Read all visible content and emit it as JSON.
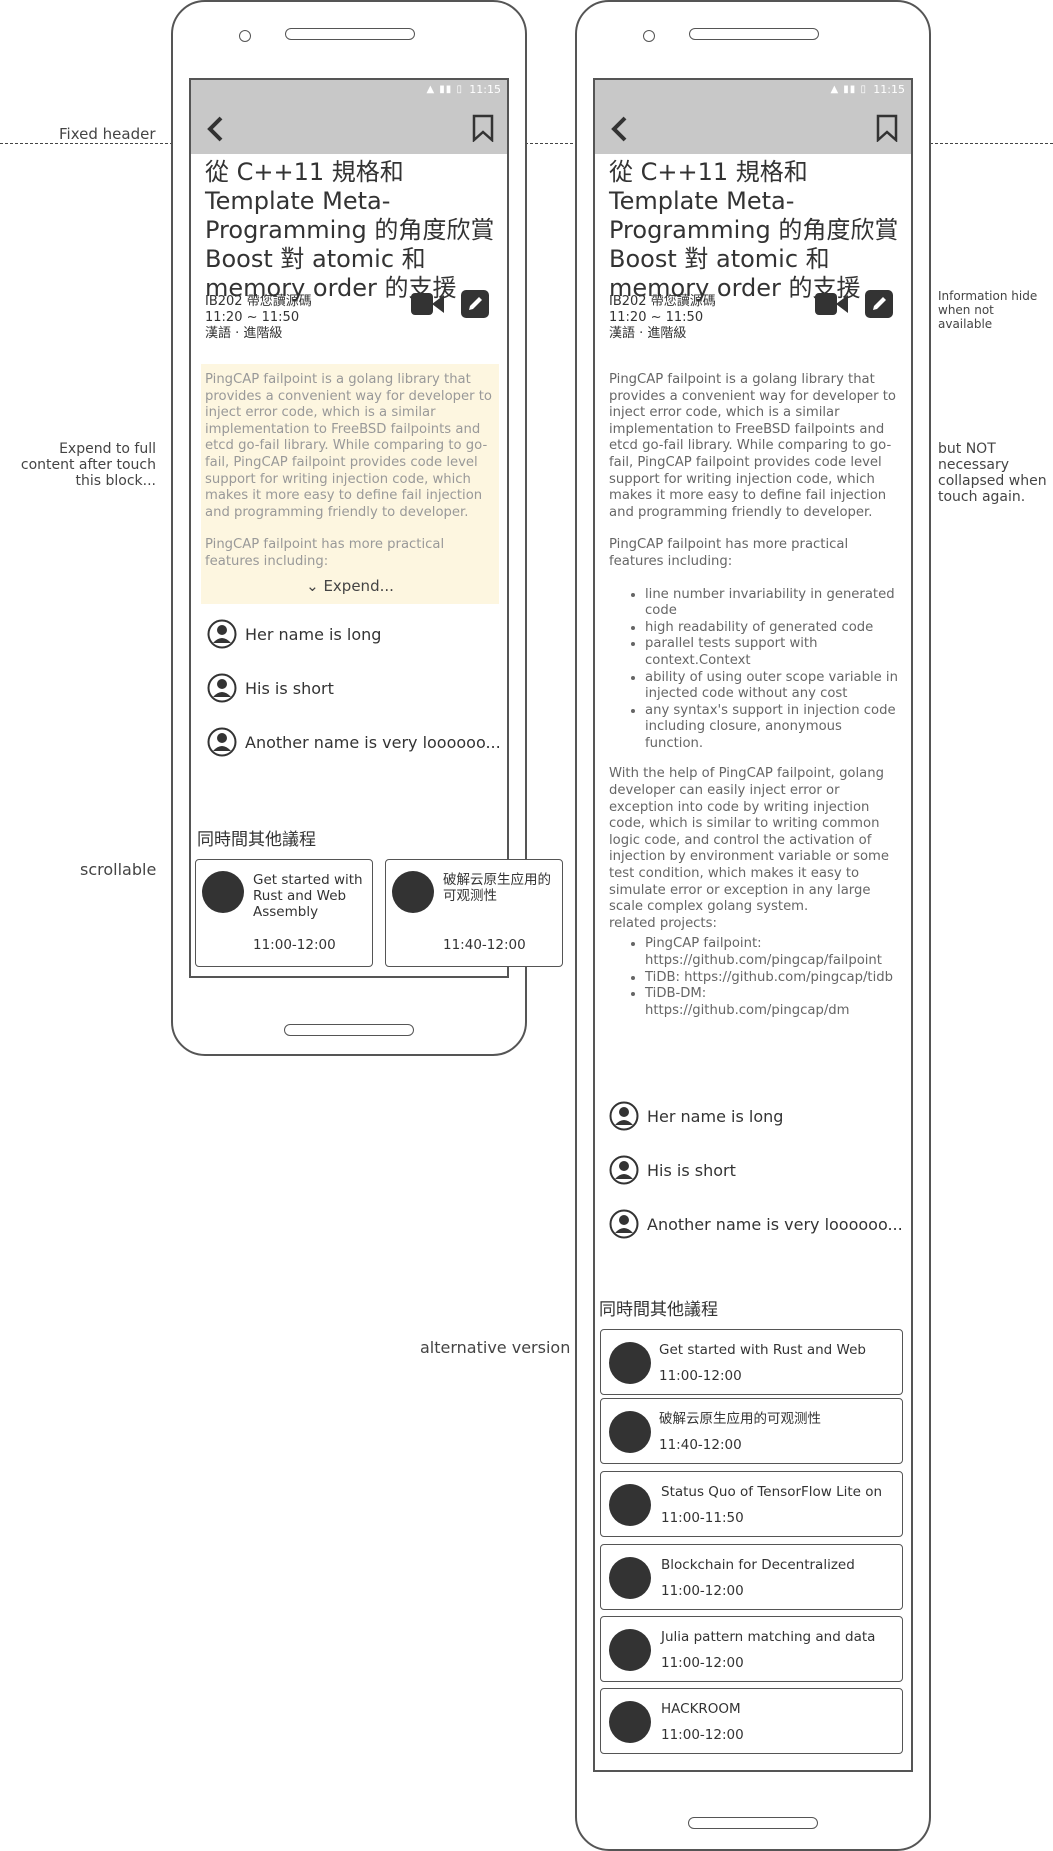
{
  "notes": {
    "fixed_header": "Fixed header",
    "expand": "Expend to full content after touch this block...",
    "scrollable": "scrollable",
    "info_hide": "Information hide when not available",
    "not_collapsed": "but NOT necessary collapsed when touch again.",
    "alt_version": "alternative version"
  },
  "status": {
    "time": "11:15"
  },
  "session": {
    "title": "從 C++11 規格和 Template Meta-Programming 的角度欣賞 Boost 對 atomic 和 memory order 的支援",
    "room": "IB202  帶您讀源碼",
    "time": "11:20 ~ 11:50",
    "lang_level": "漢語 · 進階級"
  },
  "description": {
    "p1": "PingCAP failpoint is a golang library that provides a convenient way for developer to inject error code, which is a similar implementation to FreeBSD failpoints and etcd go-fail library. While comparing to go-fail, PingCAP failpoint provides code level support for writing injection code, which makes it more easy to define fail injection and programming friendly to developer.",
    "p2": "PingCAP failpoint has more practical features including:",
    "features": [
      "line number invariability in generated code",
      "high readability of generated code",
      "parallel tests support with context.Context",
      "ability of using outer scope variable in injected code without any cost",
      "any syntax's support in injection code including closure, anonymous function."
    ],
    "p3": "With the help of PingCAP failpoint, golang developer can easily inject error or exception into code by writing injection code, which is similar to writing common logic code, and control the activation of injection by environment variable or some test condition, which makes it easy to simulate error or exception in any large scale complex golang system.",
    "related_label": "related projects:",
    "projects": [
      "PingCAP failpoint: https://github.com/pingcap/failpoint",
      "TiDB: https://github.com/pingcap/tidb",
      "TiDB-DM: https://github.com/pingcap/dm"
    ],
    "expand_label": "Expend..."
  },
  "speakers": [
    "Her name is long",
    "His is short",
    "Another name is very loooooo..."
  ],
  "other_sessions": {
    "title": "同時間其他議程",
    "items": [
      {
        "title": "Get started with Rust and Web Assembly",
        "time": "11:00-12:00"
      },
      {
        "title": "破解云原生应用的可观测性",
        "time": "11:40-12:00"
      },
      {
        "title": "Status Quo of TensorFlow Lite on",
        "time": "11:00-11:50"
      },
      {
        "title": "Blockchain for Decentralized",
        "time": "11:00-12:00"
      },
      {
        "title": "Julia pattern matching and data",
        "time": "11:00-12:00"
      },
      {
        "title": "HACKROOM",
        "time": "11:00-12:00"
      }
    ],
    "alt_first_title": "Get started with Rust and Web"
  }
}
